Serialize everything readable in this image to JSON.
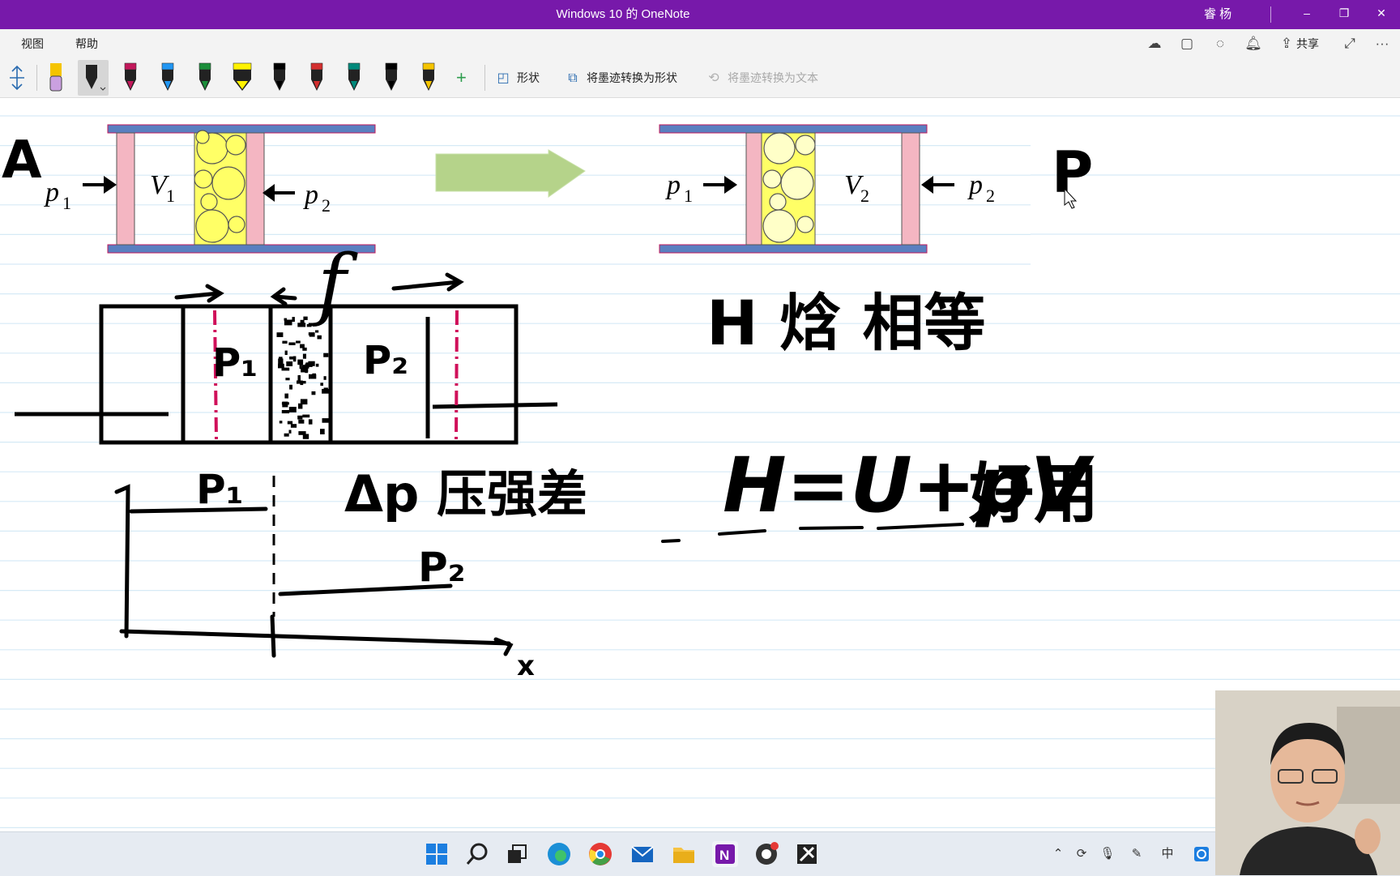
{
  "window": {
    "title": "Windows 10 的 OneNote",
    "user": "睿 杨",
    "minimize": "–",
    "restore": "❐",
    "close": "✕"
  },
  "menu": {
    "items": [
      "视图",
      "帮助"
    ],
    "share_label": "共享",
    "more": "···"
  },
  "toolbar": {
    "pen_colors": [
      "#000000",
      "#c2185b",
      "#2196f3",
      "#1b8e3a",
      "#fff200",
      "#000000",
      "#d32f2f",
      "#00897b",
      "#000000",
      "#f5c400"
    ],
    "add_pen": "+",
    "shapes_label": "形状",
    "ink_to_shape_label": "将墨迹转换为形状",
    "ink_to_text_label": "将墨迹转换为文本"
  },
  "figure": {
    "left": {
      "p1": "p",
      "p1_sub": "1",
      "v1": "V",
      "v1_sub": "1",
      "p2": "p",
      "p2_sub": "2"
    },
    "right": {
      "p1": "p",
      "p1_sub": "1",
      "v2": "V",
      "v2_sub": "2",
      "p2": "p",
      "p2_sub": "2"
    }
  },
  "handwriting": {
    "A": "A",
    "P_right": "P",
    "f": "f",
    "P1_box": "P₁",
    "P2_box": "P₂",
    "P1_graph": "P₁",
    "P2_graph": "P₂",
    "dp_label": "Δp 压强差",
    "H_enthalpy": "H 焓 相等",
    "equation": "H=U+pV",
    "useful": "好用",
    "x_axis": "x"
  },
  "colors": {
    "title_bar": "#7719aa",
    "piston": "#f4b6c2",
    "wall": "#5a7fc0",
    "plug": "#ffff66",
    "arrow_green": "#b5d38a",
    "dashed_red": "#d0105a"
  }
}
